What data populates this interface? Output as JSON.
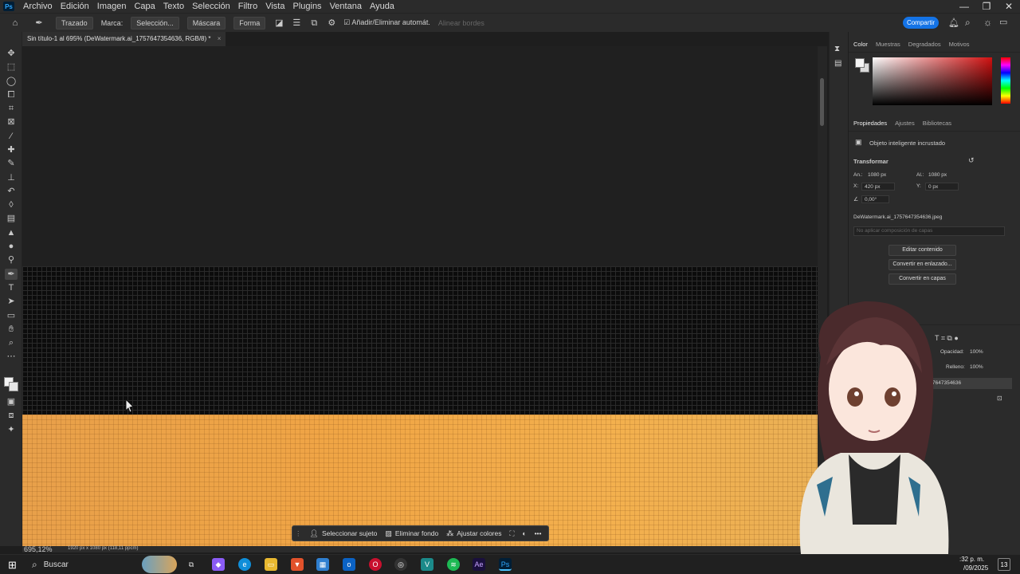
{
  "app": {
    "menu": [
      "Archivo",
      "Edición",
      "Imagen",
      "Capa",
      "Texto",
      "Selección",
      "Filtro",
      "Vista",
      "Plugins",
      "Ventana",
      "Ayuda"
    ],
    "ps_badge": "Ps",
    "window_controls": [
      "—",
      "❐",
      "✕"
    ]
  },
  "options_bar": {
    "home_icon": "home-icon",
    "mode_label": "Trazado",
    "marca_label": "Marca:",
    "seleccion_btn": "Selección...",
    "mascara_btn": "Máscara",
    "forma_btn": "Forma",
    "auto_add_label": "Añadir/Eliminar automát.",
    "align_edges_label": "Alinear bordes",
    "share_label": "Compartir"
  },
  "document": {
    "tab_title": "Sin título-1 al 695% (DeWatermark.ai_1757647354636, RGB/8) *",
    "tab_close": "×"
  },
  "status": {
    "zoom": "695,12%",
    "doc_size": "1920 px x 1080 px (118,11 ppcm)"
  },
  "contextual_bar": {
    "select_subject": "Seleccionar sujeto",
    "remove_background": "Eliminar fondo",
    "adjust_colors": "Ajustar colores"
  },
  "color_panel": {
    "tabs": [
      "Color",
      "Muestras",
      "Degradados",
      "Motivos"
    ],
    "active_tab": "Color"
  },
  "properties_panel": {
    "tabs": [
      "Propiedades",
      "Ajustes",
      "Bibliotecas"
    ],
    "active_tab": "Propiedades",
    "object_type": "Objeto inteligente incrustado",
    "transform_heading": "Transformar",
    "width_label": "An.:",
    "width_value": "1080 px",
    "height_label": "Al.:",
    "height_value": "1080 px",
    "x_label": "X:",
    "x_value": "420 px",
    "y_label": "Y:",
    "y_value": "0 px",
    "angle_value": "0,00°",
    "linked_file": "DeWatermark.ai_1757647354636.jpeg",
    "layer_comp_placeholder": "No aplicar composición de capas",
    "edit_contents": "Editar contenido",
    "convert_linked": "Convertir en enlazado...",
    "convert_layers": "Convertir en capas"
  },
  "layers_panel": {
    "opacity_label": "Opacidad:",
    "opacity_value": "100%",
    "fill_label": "Relleno:",
    "fill_value": "100%",
    "layer_name_partial": "7647354636"
  },
  "taskbar": {
    "search_label": "Buscar",
    "clock_time": ":32 p. m.",
    "clock_date": "/09/2025",
    "notification_count": "13"
  },
  "colors": {
    "accent_blue": "#1473e6",
    "canvas_orange": "#f0a545",
    "panel_bg": "#2b2b2b"
  }
}
